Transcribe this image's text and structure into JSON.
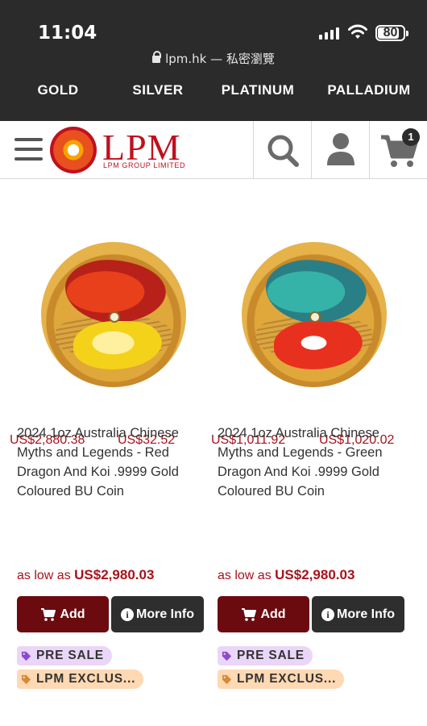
{
  "status": {
    "time": "11:04",
    "battery": "80",
    "url": "lpm.hk — 私密瀏覽"
  },
  "metals": [
    {
      "name": "GOLD",
      "price": "US$2,880.38"
    },
    {
      "name": "SILVER",
      "price": "US$32.52"
    },
    {
      "name": "PLATINUM",
      "price": "US$1,011.92"
    },
    {
      "name": "PALLADIUM",
      "price": "US$1,020.02"
    }
  ],
  "header": {
    "logo": "LPM",
    "logo_sub": "LPM GROUP LIMITED",
    "cart_count": "1"
  },
  "products": [
    {
      "title": "2024 1oz Australia Chinese Myths and Legends - Red Dragon And Koi .9999 Gold Coloured BU Coin",
      "price_prefix": "as low as",
      "price": "US$2,980.03",
      "add_label": "Add",
      "info_label": "More Info",
      "tag1": "PRE SALE",
      "tag2": "LPM EXCLUS..."
    },
    {
      "title": "2024 1oz Australia Chinese Myths and Legends - Green Dragon And Koi .9999 Gold Coloured BU Coin",
      "price_prefix": "as low as",
      "price": "US$2,980.03",
      "add_label": "Add",
      "info_label": "More Info",
      "tag1": "PRE SALE",
      "tag2": "LPM EXCLUS..."
    }
  ],
  "colors": {
    "brand_red": "#c0101e",
    "price_red": "#a8121b",
    "add_button": "#6b0b10",
    "info_button": "#2e2e2e",
    "dark_bar": "#2b2b2b"
  },
  "icons": [
    "lock-icon",
    "signal-icon",
    "wifi-icon",
    "battery-icon",
    "hamburger-icon",
    "search-icon",
    "user-icon",
    "cart-icon",
    "info-icon",
    "tag-icon"
  ]
}
